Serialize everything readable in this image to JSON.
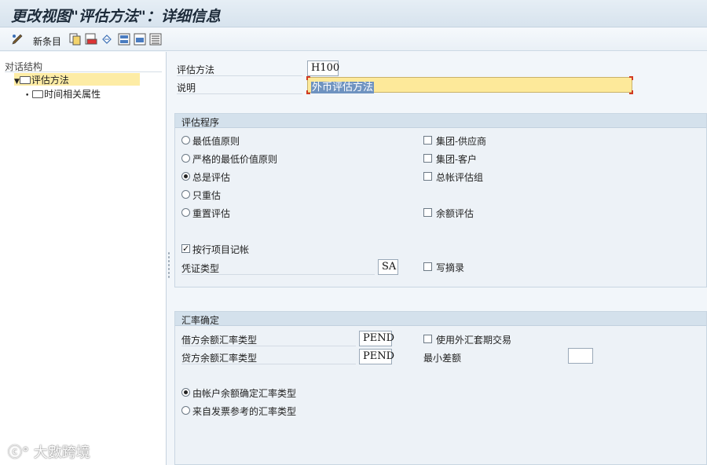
{
  "window": {
    "title": "更改视图\"评估方法\"：详细信息"
  },
  "toolbar": {
    "new_entry_label": "新条目"
  },
  "tree": {
    "header": "对话结构",
    "items": [
      {
        "label": "评估方法",
        "selected": true
      },
      {
        "label": "时间相关属性",
        "selected": false
      }
    ]
  },
  "header_fields": {
    "method_label": "评估方法",
    "method_value": "H100",
    "desc_label": "说明",
    "desc_value": "外币评估方法"
  },
  "valuation_procedure": {
    "title": "评估程序",
    "radios": [
      {
        "label": "最低值原则",
        "checked": false
      },
      {
        "label": "严格的最低价值原则",
        "checked": false
      },
      {
        "label": "总是评估",
        "checked": true
      },
      {
        "label": "只重估",
        "checked": false
      },
      {
        "label": "重置评估",
        "checked": false
      }
    ],
    "checkboxes": [
      {
        "label": "集团-供应商",
        "checked": false
      },
      {
        "label": "集团-客户",
        "checked": false
      },
      {
        "label": "总帐评估组",
        "checked": false
      },
      {
        "label": "余额评估",
        "checked": false
      }
    ],
    "line_item_posting": {
      "label": "按行项目记帐",
      "checked": true
    },
    "doc_type_label": "凭证类型",
    "doc_type_value": "SA",
    "write_log": {
      "label": "写摘录",
      "checked": false
    }
  },
  "exchange_rate": {
    "title": "汇率确定",
    "debit_label": "借方余额汇率类型",
    "debit_value": "PEND",
    "credit_label": "贷方余额汇率类型",
    "credit_value": "PEND",
    "use_forward": {
      "label": "使用外汇套期交易",
      "checked": false
    },
    "min_diff_label": "最小差额",
    "min_diff_value": "",
    "radios": [
      {
        "label": "由帐户余额确定汇率类型",
        "checked": true
      },
      {
        "label": "来自发票参考的汇率类型",
        "checked": false
      }
    ]
  },
  "watermark": "大數跨境",
  "colors": {
    "selection": "#fdeca5",
    "required_marker": "#d23a22",
    "group_header": "#d4e1ec"
  }
}
